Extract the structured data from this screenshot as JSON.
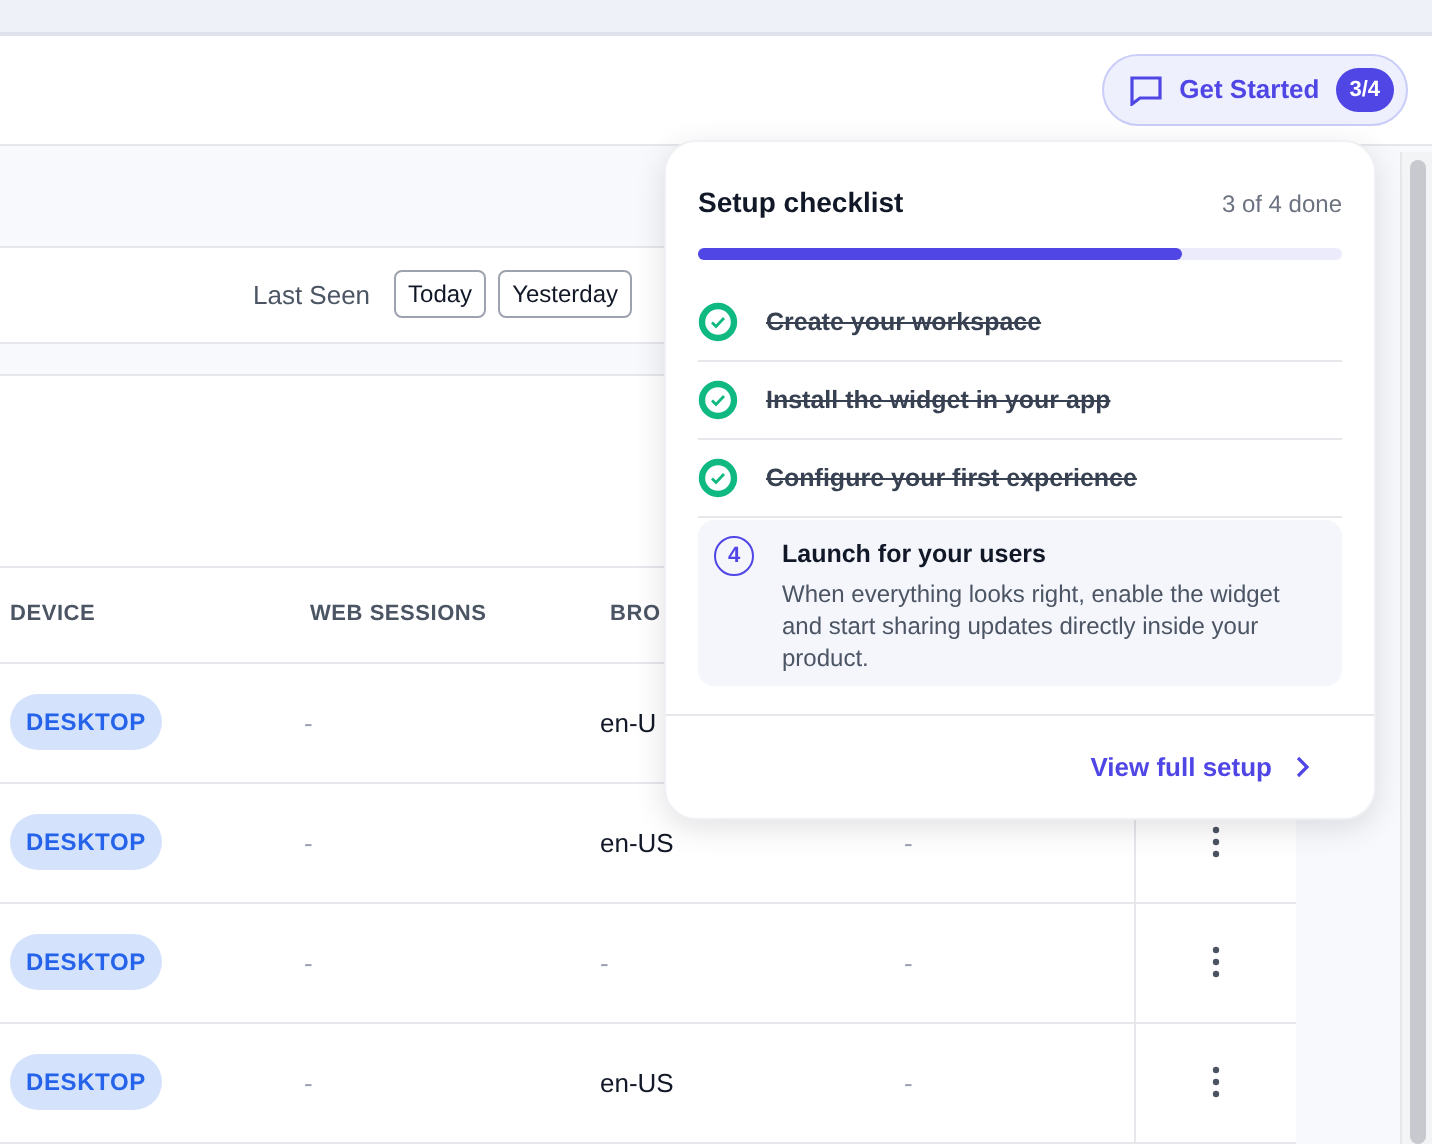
{
  "header": {
    "get_started": {
      "label": "Get Started",
      "badge": "3/4"
    }
  },
  "filter": {
    "label": "Last Seen",
    "options": [
      "Today",
      "Yesterday"
    ]
  },
  "table": {
    "columns": [
      "DEVICE",
      "WEB SESSIONS",
      "BRO"
    ],
    "rows": [
      {
        "device": "DESKTOP",
        "web_sessions": "-",
        "browser": "en-U"
      },
      {
        "device": "DESKTOP",
        "web_sessions": "-",
        "browser": "en-US",
        "column_4": "-",
        "menu": true
      },
      {
        "device": "DESKTOP",
        "web_sessions": "-",
        "browser": "-",
        "column_4": "-",
        "menu": true
      },
      {
        "device": "DESKTOP",
        "web_sessions": "-",
        "browser": "en-US",
        "column_4": "-",
        "menu": true
      }
    ]
  },
  "checklist": {
    "title": "Setup checklist",
    "count": "3 of 4 done",
    "level": 0.75,
    "items": [
      {
        "label": "Create your workspace",
        "done": true
      },
      {
        "label": "Install the widget in your app",
        "done": true
      },
      {
        "label": "Configure your first experience",
        "done": true
      },
      {
        "label": "Launch for your users",
        "done": false,
        "number": "4",
        "description": "When everything looks right, enable the widget and start sharing updates directly inside your product."
      }
    ],
    "link": "View full setup"
  }
}
